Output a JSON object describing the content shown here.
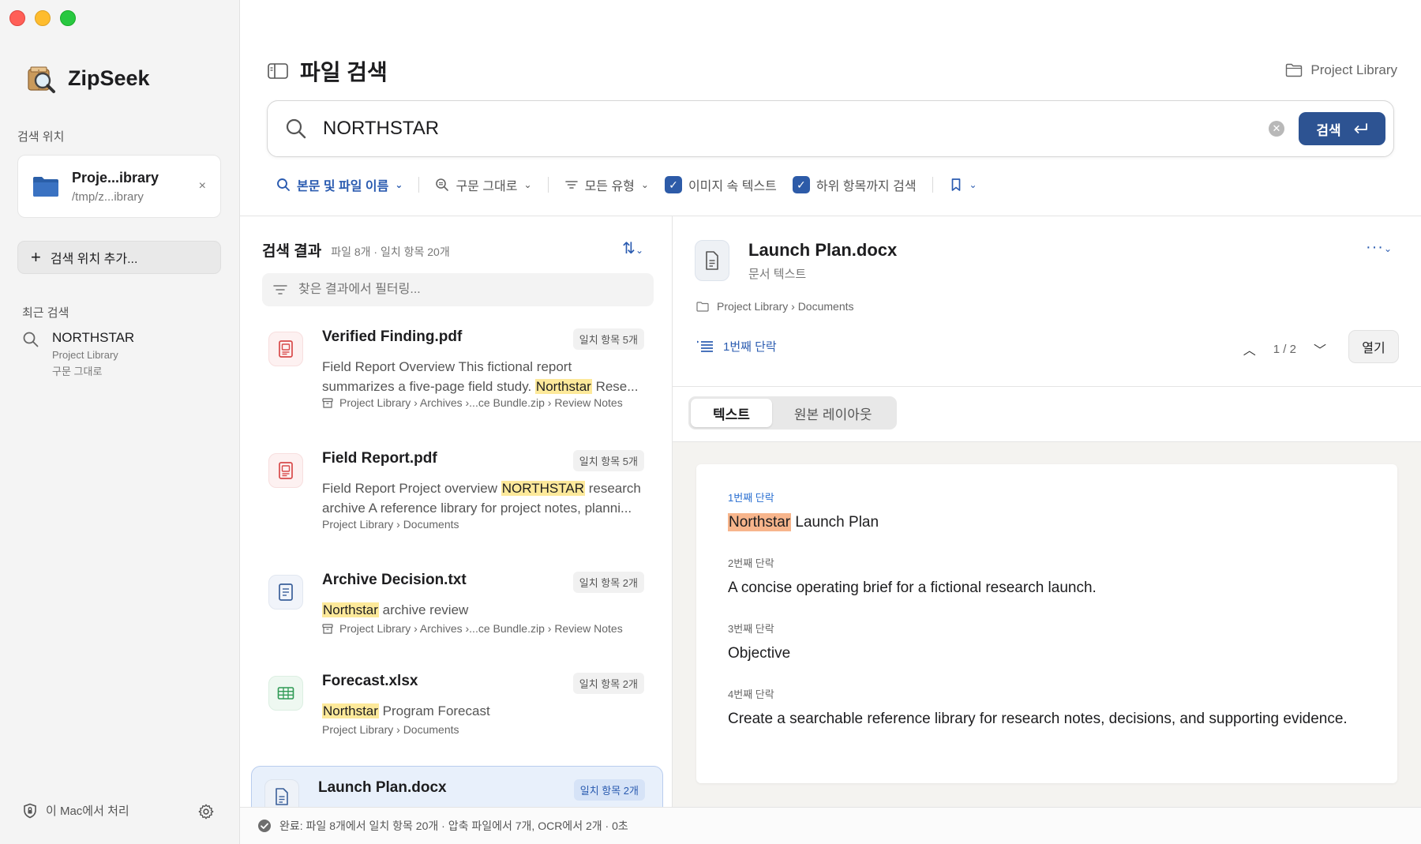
{
  "app": {
    "name": "ZipSeek"
  },
  "sidebar": {
    "search_location_label": "검색 위치",
    "location": {
      "name": "Proje...ibrary",
      "path": "/tmp/z...ibrary",
      "close": "×"
    },
    "add_location": "검색 위치 추가...",
    "recent_label": "최근 검색",
    "recent": [
      {
        "query": "NORTHSTAR",
        "scope": "Project Library",
        "mode": "구문 그대로"
      }
    ],
    "footer_text": "이 Mac에서 처리"
  },
  "header": {
    "title": "파일 검색",
    "library_link": "Project Library"
  },
  "search": {
    "query": "NORTHSTAR",
    "button_label": "검색"
  },
  "filters": {
    "scope": "본문 및 파일 이름",
    "match": "구문 그대로",
    "type": "모든 유형",
    "ocr": "이미지 속 텍스트",
    "recursive": "하위 항목까지 검색"
  },
  "results": {
    "title": "검색 결과",
    "meta": "파일 8개 · 일치 항목 20개",
    "filter_placeholder": "찾은 결과에서 필터링...",
    "items": [
      {
        "name": "Verified Finding.pdf",
        "badge": "일치 항목 5개",
        "pre": "Field Report Overview This fictional report summarizes a five-page field study. ",
        "hl": "Northstar",
        "post": " Rese...",
        "path": "Project Library › Archives ›...ce Bundle.zip › Review Notes"
      },
      {
        "name": "Field Report.pdf",
        "badge": "일치 항목 5개",
        "pre": "Field Report Project overview ",
        "hl": "NORTHSTAR",
        "post": " research archive A reference library for project notes, planni...",
        "path": "Project Library › Documents"
      },
      {
        "name": "Archive Decision.txt",
        "badge": "일치 항목 2개",
        "pre": "",
        "hl": "Northstar",
        "post": " archive review",
        "path": "Project Library › Archives ›...ce Bundle.zip › Review Notes"
      },
      {
        "name": "Forecast.xlsx",
        "badge": "일치 항목 2개",
        "pre": "",
        "hl": "Northstar",
        "post": " Program Forecast",
        "path": "Project Library › Documents"
      },
      {
        "name": "Launch Plan.docx",
        "badge": "일치 항목 2개"
      }
    ]
  },
  "preview": {
    "name": "Launch Plan.docx",
    "type": "문서 텍스트",
    "path": "Project Library › Documents",
    "current_para": "1번째 단락",
    "counter": "1 / 2",
    "open": "열기",
    "tabs": [
      "텍스트",
      "원본 레이아웃"
    ],
    "paragraphs": [
      {
        "num": "1번째 단락",
        "hl": "Northstar",
        "text": " Launch Plan"
      },
      {
        "num": "2번째 단락",
        "text": "A concise operating brief for a fictional research launch."
      },
      {
        "num": "3번째 단락",
        "text": "Objective"
      },
      {
        "num": "4번째 단락",
        "text": "Create a searchable reference library for research notes, decisions, and supporting evidence."
      }
    ]
  },
  "status": {
    "text": "완료: 파일 8개에서 일치 항목 20개 · 압축 파일에서 7개, OCR에서 2개 · 0초"
  }
}
